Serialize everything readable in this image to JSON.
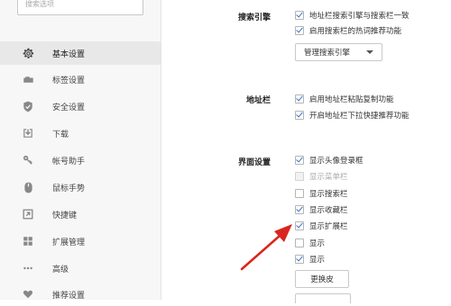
{
  "sidebar": {
    "search_placeholder": "搜索选项",
    "items": [
      {
        "label": "基本设置",
        "icon": "gear-icon"
      },
      {
        "label": "标签设置",
        "icon": "tab-icon"
      },
      {
        "label": "安全设置",
        "icon": "shield-icon"
      },
      {
        "label": "下载",
        "icon": "download-icon"
      },
      {
        "label": "帐号助手",
        "icon": "key-icon"
      },
      {
        "label": "鼠标手势",
        "icon": "mouse-icon"
      },
      {
        "label": "快捷键",
        "icon": "shortcut-arrow-icon"
      },
      {
        "label": "扩展管理",
        "icon": "grid-icon"
      },
      {
        "label": "高级",
        "icon": "dots-icon"
      },
      {
        "label": "推荐设置",
        "icon": "heart-icon"
      }
    ],
    "active_index": 0
  },
  "search_engine": {
    "title": "搜索引擎",
    "options": [
      {
        "label": "地址栏搜索引擎与搜索栏一致",
        "checked": true
      },
      {
        "label": "启用搜索栏的热词推荐功能",
        "checked": true
      }
    ],
    "manage_button": "管理搜索引擎"
  },
  "address_bar": {
    "title": "地址栏",
    "options": [
      {
        "label": "启用地址栏粘贴复制功能",
        "checked": true
      },
      {
        "label": "开启地址栏下拉快捷推荐功能",
        "checked": true
      }
    ]
  },
  "interface": {
    "title": "界面设置",
    "options": [
      {
        "label": "显示头像登录框",
        "checked": true
      },
      {
        "label": "显示菜单栏",
        "checked": false,
        "disabled": true
      },
      {
        "label": "显示搜索栏",
        "checked": false
      },
      {
        "label": "显示收藏栏",
        "checked": true
      },
      {
        "label": "显示扩展栏",
        "checked": true
      },
      {
        "label": "显示",
        "checked": false
      },
      {
        "label": "显示",
        "checked": true
      }
    ],
    "theme_button": "更换皮"
  },
  "colors": {
    "accent": "#3a72c4",
    "annotation_arrow": "#d9261c"
  }
}
